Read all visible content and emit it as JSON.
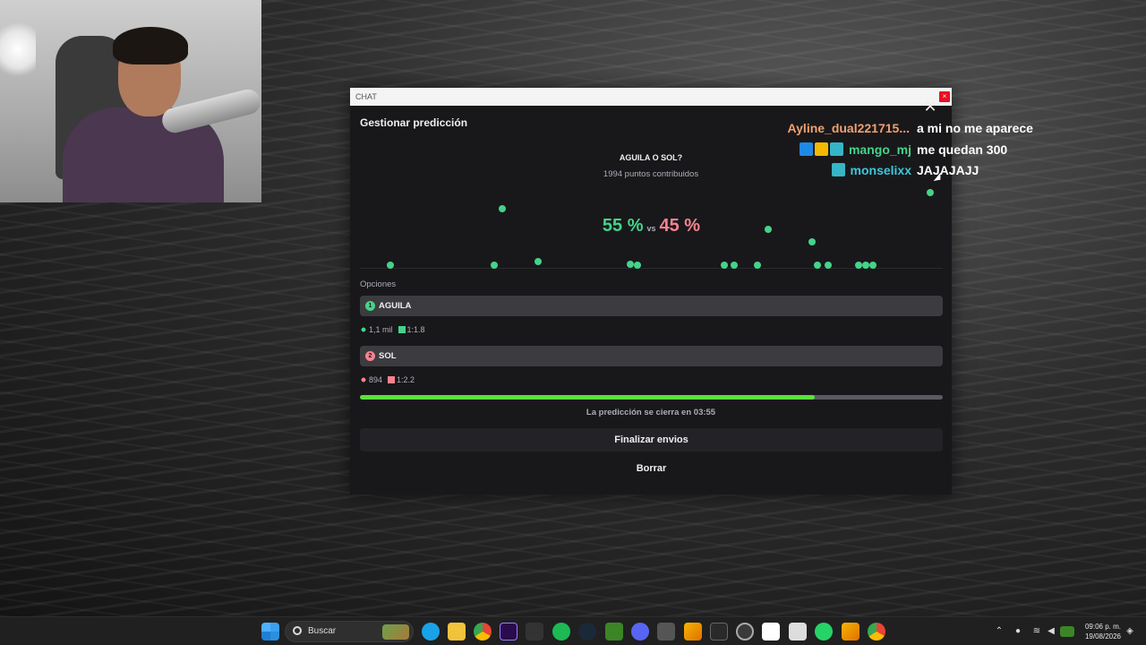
{
  "popout": {
    "window_title": "CHAT",
    "panel_title": "Gestionar predicción",
    "prediction_title": "AGUILA O SOL?",
    "points_contributed": "1994 puntos contribuidos",
    "percent_a": "55 %",
    "vs": "vs",
    "percent_b": "45 %",
    "options_label": "Opciones",
    "options": [
      {
        "number": "1",
        "label": "AGUILA",
        "users": "1,1 mil",
        "ratio": "1:1.8",
        "color": "#45d389"
      },
      {
        "number": "2",
        "label": "SOL",
        "users": "894",
        "ratio": "1:2.2",
        "color": "#f5838f"
      }
    ],
    "time_remaining_fraction": 0.78,
    "closes_text": "La predicción se cierra en 03:55",
    "end_button": "Finalizar envios",
    "delete_button": "Borrar"
  },
  "chat": [
    {
      "user": "Ayline_dual221715...",
      "message": "a mi no me aparece",
      "color": "#f0a070"
    },
    {
      "user": "mango_mj",
      "message": "me quedan 300",
      "color": "#45d389",
      "badges": [
        "moderator",
        "crown",
        "gift"
      ]
    },
    {
      "user": "monselixx",
      "message": "JAJAJAJJ",
      "color": "#3ec6d8",
      "badges": [
        "gift"
      ]
    }
  ],
  "taskbar": {
    "search_placeholder": "Buscar",
    "time": "09:06 p. m.",
    "date": "19/08/2026"
  },
  "colors": {
    "blue_outcome": "#45d389",
    "pink_outcome": "#f5838f",
    "progress": "#5be13a"
  }
}
